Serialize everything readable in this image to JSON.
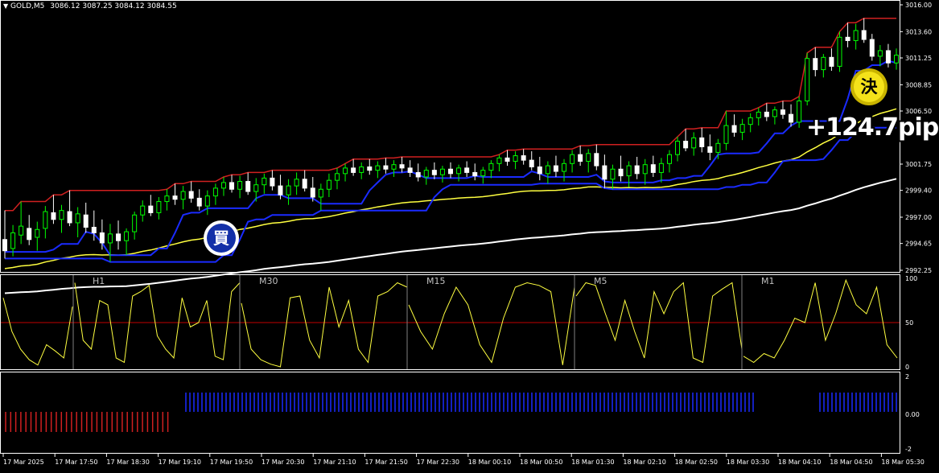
{
  "header": {
    "symbol_label": "GOLD,M5",
    "ohlc": "3086.12 3087.25 3084.12 3084.55",
    "menu_icon": "triangle-down-icon"
  },
  "price_axis": {
    "labels": [
      "3016.00",
      "3013.60",
      "3011.25",
      "3008.85",
      "3006.50",
      "3001.75",
      "2999.40",
      "2997.00",
      "2994.65",
      "2992.25"
    ],
    "values": [
      3016.0,
      3013.6,
      3011.25,
      3008.85,
      3006.5,
      3001.75,
      2999.4,
      2997.0,
      2994.65,
      2992.25
    ]
  },
  "time_axis": {
    "labels": [
      "17 Mar 2025",
      "17 Mar 17:50",
      "17 Mar 18:30",
      "17 Mar 19:10",
      "17 Mar 19:50",
      "17 Mar 20:30",
      "17 Mar 21:10",
      "17 Mar 21:50",
      "17 Mar 22:30",
      "18 Mar 00:10",
      "18 Mar 00:50",
      "18 Mar 01:30",
      "18 Mar 02:10",
      "18 Mar 02:50",
      "18 Mar 03:30",
      "18 Mar 04:10",
      "18 Mar 04:50",
      "18 Mar 05:30"
    ]
  },
  "signals": {
    "buy_badge": "買",
    "close_badge": "決",
    "profit_text": "+124.7pips"
  },
  "oscillator_panel": {
    "timeframes": [
      "H1",
      "M30",
      "M15",
      "M5",
      "M1"
    ],
    "scale_labels": [
      "100",
      "50",
      "0"
    ],
    "level_line": 50
  },
  "signal_panel": {
    "scale_labels": [
      "2",
      "0.00",
      "-2"
    ]
  },
  "colors": {
    "background": "#000000",
    "bull_candle": "#00ff00",
    "bear_candle": "#ffffff",
    "upper_band": "#d02020",
    "lower_band": "#1a2bff",
    "ma_fast": "#ffff40",
    "ma_slow": "#ffffff",
    "oscillator": "#ffff40",
    "level_line": "#c00000",
    "sell_hist": "#d02020",
    "buy_hist": "#1a2bff"
  },
  "chart_data": {
    "type": "candlestick",
    "symbol": "GOLD",
    "timeframe": "M5",
    "last_ohlc": {
      "open": 3086.12,
      "high": 3087.25,
      "low": 3084.12,
      "close": 3084.55
    },
    "ylim": [
      2992.25,
      3016.0
    ],
    "candles": [
      {
        "o": 2995.0,
        "h": 2997.6,
        "l": 2993.3,
        "c": 2994.0
      },
      {
        "o": 2994.2,
        "h": 2996.3,
        "l": 2993.5,
        "c": 2995.6
      },
      {
        "o": 2995.4,
        "h": 2998.4,
        "l": 2994.6,
        "c": 2996.2
      },
      {
        "o": 2996.0,
        "h": 2997.2,
        "l": 2994.5,
        "c": 2995.0
      },
      {
        "o": 2995.2,
        "h": 2996.6,
        "l": 2994.0,
        "c": 2995.9
      },
      {
        "o": 2996.0,
        "h": 2998.0,
        "l": 2995.1,
        "c": 2997.5
      },
      {
        "o": 2997.4,
        "h": 2999.0,
        "l": 2996.4,
        "c": 2996.8
      },
      {
        "o": 2996.8,
        "h": 2998.1,
        "l": 2995.6,
        "c": 2997.6
      },
      {
        "o": 2997.5,
        "h": 2999.4,
        "l": 2996.2,
        "c": 2996.5
      },
      {
        "o": 2996.5,
        "h": 2997.9,
        "l": 2995.2,
        "c": 2997.3
      },
      {
        "o": 2997.2,
        "h": 2998.3,
        "l": 2995.6,
        "c": 2996.1
      },
      {
        "o": 2996.1,
        "h": 2997.6,
        "l": 2994.9,
        "c": 2995.6
      },
      {
        "o": 2995.6,
        "h": 2996.8,
        "l": 2994.1,
        "c": 2994.7
      },
      {
        "o": 2994.7,
        "h": 2996.4,
        "l": 2993.0,
        "c": 2995.5
      },
      {
        "o": 2995.5,
        "h": 2996.7,
        "l": 2994.1,
        "c": 2994.9
      },
      {
        "o": 2994.9,
        "h": 2996.0,
        "l": 2993.6,
        "c": 2995.7
      },
      {
        "o": 2995.7,
        "h": 2997.5,
        "l": 2995.0,
        "c": 2997.2
      },
      {
        "o": 2997.2,
        "h": 2998.5,
        "l": 2996.6,
        "c": 2998.0
      },
      {
        "o": 2998.0,
        "h": 2999.0,
        "l": 2997.1,
        "c": 2997.4
      },
      {
        "o": 2997.4,
        "h": 2998.8,
        "l": 2996.8,
        "c": 2998.4
      },
      {
        "o": 2998.4,
        "h": 2999.5,
        "l": 2997.6,
        "c": 2998.9
      },
      {
        "o": 2998.9,
        "h": 3000.0,
        "l": 2998.1,
        "c": 2998.6
      },
      {
        "o": 2998.6,
        "h": 2999.8,
        "l": 2997.7,
        "c": 2999.3
      },
      {
        "o": 2999.3,
        "h": 3000.2,
        "l": 2998.3,
        "c": 2998.7
      },
      {
        "o": 2998.7,
        "h": 2999.5,
        "l": 2997.6,
        "c": 2998.0
      },
      {
        "o": 2998.0,
        "h": 2999.4,
        "l": 2997.2,
        "c": 2998.9
      },
      {
        "o": 2998.9,
        "h": 3000.0,
        "l": 2998.1,
        "c": 2999.6
      },
      {
        "o": 2999.6,
        "h": 3000.6,
        "l": 2998.9,
        "c": 3000.1
      },
      {
        "o": 3000.1,
        "h": 3000.8,
        "l": 2999.2,
        "c": 2999.5
      },
      {
        "o": 2999.5,
        "h": 3000.7,
        "l": 2998.7,
        "c": 3000.2
      },
      {
        "o": 3000.2,
        "h": 3001.0,
        "l": 2999.0,
        "c": 2999.3
      },
      {
        "o": 2999.3,
        "h": 3000.5,
        "l": 2998.4,
        "c": 2999.9
      },
      {
        "o": 2999.9,
        "h": 3000.9,
        "l": 2999.1,
        "c": 3000.5
      },
      {
        "o": 3000.5,
        "h": 3001.2,
        "l": 2999.4,
        "c": 2999.8
      },
      {
        "o": 2999.8,
        "h": 3000.8,
        "l": 2998.6,
        "c": 2999.0
      },
      {
        "o": 2999.0,
        "h": 3000.4,
        "l": 2998.1,
        "c": 2999.8
      },
      {
        "o": 2999.8,
        "h": 3001.0,
        "l": 2999.0,
        "c": 3000.4
      },
      {
        "o": 3000.4,
        "h": 3001.2,
        "l": 2999.3,
        "c": 2999.6
      },
      {
        "o": 2999.6,
        "h": 3000.6,
        "l": 2998.4,
        "c": 2998.8
      },
      {
        "o": 2998.8,
        "h": 3000.0,
        "l": 2997.6,
        "c": 2999.5
      },
      {
        "o": 2999.5,
        "h": 3000.9,
        "l": 2998.8,
        "c": 3000.3
      },
      {
        "o": 3000.3,
        "h": 3001.4,
        "l": 2999.5,
        "c": 3000.9
      },
      {
        "o": 3000.9,
        "h": 3001.8,
        "l": 3000.2,
        "c": 3001.4
      },
      {
        "o": 3001.4,
        "h": 3002.2,
        "l": 3000.7,
        "c": 3001.0
      },
      {
        "o": 3001.0,
        "h": 3001.9,
        "l": 3000.4,
        "c": 3001.5
      },
      {
        "o": 3001.5,
        "h": 3002.2,
        "l": 3000.8,
        "c": 3001.2
      },
      {
        "o": 3001.2,
        "h": 3002.0,
        "l": 3000.5,
        "c": 3001.6
      },
      {
        "o": 3001.6,
        "h": 3002.3,
        "l": 3000.9,
        "c": 3001.3
      },
      {
        "o": 3001.3,
        "h": 3002.1,
        "l": 3000.6,
        "c": 3001.7
      },
      {
        "o": 3001.7,
        "h": 3002.4,
        "l": 3001.0,
        "c": 3001.4
      },
      {
        "o": 3001.4,
        "h": 3002.1,
        "l": 3000.6,
        "c": 3001.0
      },
      {
        "o": 3001.0,
        "h": 3001.8,
        "l": 3000.2,
        "c": 3000.6
      },
      {
        "o": 3000.6,
        "h": 3001.5,
        "l": 2999.9,
        "c": 3001.2
      },
      {
        "o": 3001.2,
        "h": 3001.9,
        "l": 3000.4,
        "c": 3000.8
      },
      {
        "o": 3000.8,
        "h": 3001.6,
        "l": 3000.1,
        "c": 3001.3
      },
      {
        "o": 3001.3,
        "h": 3001.9,
        "l": 3000.5,
        "c": 3000.9
      },
      {
        "o": 3000.9,
        "h": 3001.7,
        "l": 3000.2,
        "c": 3001.4
      },
      {
        "o": 3001.4,
        "h": 3002.0,
        "l": 3000.6,
        "c": 3001.0
      },
      {
        "o": 3001.0,
        "h": 3001.8,
        "l": 3000.3,
        "c": 3000.7
      },
      {
        "o": 3000.7,
        "h": 3001.5,
        "l": 3000.0,
        "c": 3001.2
      },
      {
        "o": 3001.2,
        "h": 3002.1,
        "l": 3000.5,
        "c": 3001.8
      },
      {
        "o": 3001.8,
        "h": 3002.6,
        "l": 3001.1,
        "c": 3002.3
      },
      {
        "o": 3002.3,
        "h": 3003.0,
        "l": 3001.6,
        "c": 3002.0
      },
      {
        "o": 3002.0,
        "h": 3002.9,
        "l": 3001.3,
        "c": 3002.5
      },
      {
        "o": 3002.5,
        "h": 3003.1,
        "l": 3001.7,
        "c": 3002.1
      },
      {
        "o": 3002.1,
        "h": 3002.9,
        "l": 3001.2,
        "c": 3001.5
      },
      {
        "o": 3001.5,
        "h": 3002.4,
        "l": 3000.3,
        "c": 3000.9
      },
      {
        "o": 3000.9,
        "h": 3002.0,
        "l": 3000.0,
        "c": 3001.6
      },
      {
        "o": 3001.6,
        "h": 3002.5,
        "l": 3000.6,
        "c": 3001.1
      },
      {
        "o": 3001.1,
        "h": 3002.2,
        "l": 3000.2,
        "c": 3001.8
      },
      {
        "o": 3001.8,
        "h": 3003.0,
        "l": 3001.0,
        "c": 3002.6
      },
      {
        "o": 3002.6,
        "h": 3003.4,
        "l": 3001.6,
        "c": 3002.0
      },
      {
        "o": 3002.0,
        "h": 3003.1,
        "l": 3001.0,
        "c": 3002.7
      },
      {
        "o": 3002.7,
        "h": 3003.5,
        "l": 3001.2,
        "c": 3001.6
      },
      {
        "o": 3001.6,
        "h": 3002.6,
        "l": 2999.6,
        "c": 3000.4
      },
      {
        "o": 3000.4,
        "h": 3001.7,
        "l": 2999.5,
        "c": 3001.3
      },
      {
        "o": 3001.3,
        "h": 3002.5,
        "l": 3000.2,
        "c": 3000.7
      },
      {
        "o": 3000.7,
        "h": 3002.0,
        "l": 2999.7,
        "c": 3001.6
      },
      {
        "o": 3001.6,
        "h": 3002.4,
        "l": 3000.4,
        "c": 3000.9
      },
      {
        "o": 3000.9,
        "h": 3002.2,
        "l": 2999.9,
        "c": 3001.7
      },
      {
        "o": 3001.7,
        "h": 3002.5,
        "l": 3000.6,
        "c": 3001.0
      },
      {
        "o": 3001.0,
        "h": 3002.3,
        "l": 3000.1,
        "c": 3001.8
      },
      {
        "o": 3001.8,
        "h": 3003.0,
        "l": 3001.0,
        "c": 3002.6
      },
      {
        "o": 3002.6,
        "h": 3004.2,
        "l": 3002.0,
        "c": 3003.8
      },
      {
        "o": 3003.8,
        "h": 3004.9,
        "l": 3002.9,
        "c": 3003.2
      },
      {
        "o": 3003.2,
        "h": 3004.6,
        "l": 3002.5,
        "c": 3004.1
      },
      {
        "o": 3004.1,
        "h": 3005.0,
        "l": 3002.8,
        "c": 3003.3
      },
      {
        "o": 3003.3,
        "h": 3004.4,
        "l": 3002.1,
        "c": 3002.8
      },
      {
        "o": 3002.8,
        "h": 3004.0,
        "l": 3002.2,
        "c": 3003.6
      },
      {
        "o": 3003.6,
        "h": 3006.5,
        "l": 3003.0,
        "c": 3005.2
      },
      {
        "o": 3005.2,
        "h": 3006.2,
        "l": 3004.2,
        "c": 3004.6
      },
      {
        "o": 3004.6,
        "h": 3005.8,
        "l": 3003.9,
        "c": 3005.3
      },
      {
        "o": 3005.3,
        "h": 3006.3,
        "l": 3004.6,
        "c": 3005.9
      },
      {
        "o": 3005.9,
        "h": 3006.8,
        "l": 3005.2,
        "c": 3006.4
      },
      {
        "o": 3006.4,
        "h": 3007.2,
        "l": 3005.6,
        "c": 3006.0
      },
      {
        "o": 3006.0,
        "h": 3006.9,
        "l": 3005.3,
        "c": 3006.6
      },
      {
        "o": 3006.6,
        "h": 3007.4,
        "l": 3005.8,
        "c": 3006.2
      },
      {
        "o": 3006.2,
        "h": 3007.1,
        "l": 3005.1,
        "c": 3005.5
      },
      {
        "o": 3005.5,
        "h": 3007.8,
        "l": 3005.0,
        "c": 3007.4
      },
      {
        "o": 3007.4,
        "h": 3011.7,
        "l": 3007.0,
        "c": 3011.2
      },
      {
        "o": 3011.2,
        "h": 3012.2,
        "l": 3009.6,
        "c": 3010.2
      },
      {
        "o": 3010.2,
        "h": 3011.6,
        "l": 3009.5,
        "c": 3011.3
      },
      {
        "o": 3011.3,
        "h": 3012.1,
        "l": 3010.1,
        "c": 3010.5
      },
      {
        "o": 3010.5,
        "h": 3013.6,
        "l": 3010.0,
        "c": 3013.1
      },
      {
        "o": 3013.1,
        "h": 3014.4,
        "l": 3012.2,
        "c": 3012.8
      },
      {
        "o": 3012.8,
        "h": 3014.3,
        "l": 3012.0,
        "c": 3013.7
      },
      {
        "o": 3013.7,
        "h": 3014.8,
        "l": 3012.6,
        "c": 3012.9
      },
      {
        "o": 3012.9,
        "h": 3013.4,
        "l": 3011.0,
        "c": 3011.4
      },
      {
        "o": 3011.4,
        "h": 3012.4,
        "l": 3010.5,
        "c": 3011.9
      },
      {
        "o": 3011.9,
        "h": 3012.5,
        "l": 3010.4,
        "c": 3010.8
      },
      {
        "o": 3010.8,
        "h": 3012.1,
        "l": 3010.2,
        "c": 3011.5
      }
    ]
  }
}
